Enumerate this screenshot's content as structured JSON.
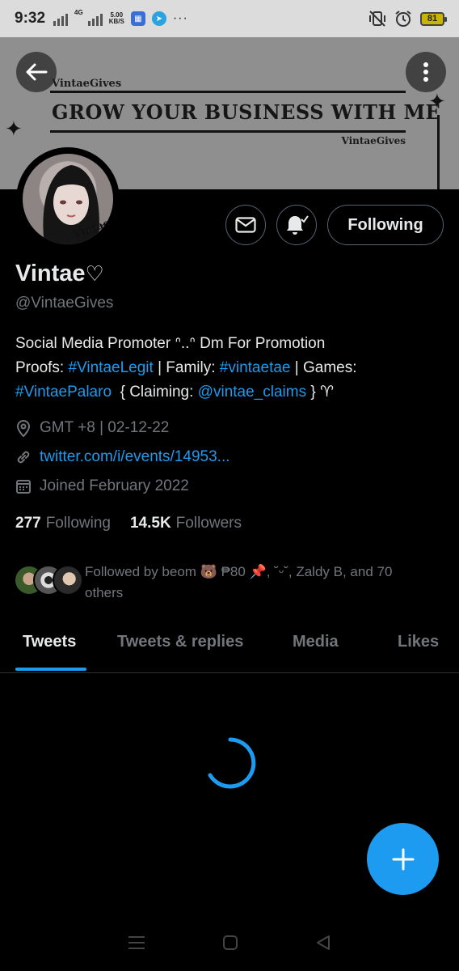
{
  "status_bar": {
    "time": "9:32",
    "net_label_top": "4G",
    "speed_value": "5.00",
    "speed_unit": "KB/S",
    "overflow": "···",
    "battery": "81"
  },
  "banner": {
    "brand_top": "VintaeGives",
    "headline": "GROW YOUR BUSINESS WITH ME",
    "brand_bottom": "VintaeGives"
  },
  "profile": {
    "avatar_text": "Vintae",
    "display_name": "Vintae",
    "name_emoji": "♡",
    "handle": "@VintaeGives",
    "bio": {
      "line1": "Social Media Promoter ᐢ..ᐢ Dm For Promotion",
      "line2_prefix": "Proofs: ",
      "tag_legit": "#VintaeLegit",
      "line2_mid": " | Family: ",
      "tag_family": "#vintaetae",
      "line2_suffix": " | Games:",
      "tag_palaro": "#VintaePalaro",
      "line3_mid": "  { Claiming: ",
      "claims_handle": "@vintae_claims",
      "line3_suffix": " } ♈"
    },
    "location": "GMT +8 | 02-12-22",
    "website": "twitter.com/i/events/14953...",
    "joined": "Joined February 2022",
    "following_count": "277",
    "following_label": "Following",
    "followers_count": "14.5K",
    "followers_label": "Followers",
    "followed_by": "Followed by beom 🐻 ₱80 📌, ˘ᵕ˘, Zaldy B, and 70 others"
  },
  "actions": {
    "follow_button": "Following"
  },
  "tabs": [
    {
      "label": "Tweets",
      "active": true
    },
    {
      "label": "Tweets & replies",
      "active": false
    },
    {
      "label": "Media",
      "active": false
    },
    {
      "label": "Likes",
      "active": false
    }
  ],
  "colors": {
    "accent": "#1d9bf0",
    "background": "#000000",
    "muted_text": "#71767b",
    "primary_text": "#e7e9ea"
  },
  "icons": [
    "back-arrow-icon",
    "more-vertical-icon",
    "message-icon",
    "notification-bell-icon",
    "location-icon",
    "link-icon",
    "calendar-icon",
    "compose-plus-icon",
    "loading-spinner-icon"
  ]
}
